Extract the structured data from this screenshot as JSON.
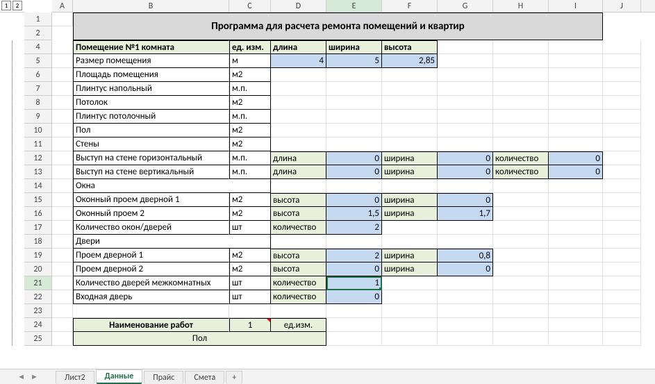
{
  "outlineLevels": [
    "1",
    "2"
  ],
  "columns": [
    "A",
    "B",
    "C",
    "D",
    "E",
    "F",
    "G",
    "H",
    "I",
    "J"
  ],
  "selectedCol": "E",
  "selectedRow": "21",
  "rows": [
    "1",
    "2",
    "4",
    "5",
    "6",
    "7",
    "8",
    "9",
    "10",
    "11",
    "12",
    "13",
    "14",
    "15",
    "16",
    "17",
    "18",
    "19",
    "20",
    "21",
    "22",
    "23",
    "24",
    "25"
  ],
  "title": "Программа для расчета ремонта помещений и квартир",
  "header": {
    "room": "Помещение №1 комната",
    "unit": "ед. изм.",
    "len": "длина",
    "wid": "ширина",
    "hgt": "высота"
  },
  "r5": {
    "name": "Размер помещения",
    "unit": "м",
    "len": "4",
    "wid": "5",
    "hgt": "2,85"
  },
  "r6": {
    "name": "Площадь помещения",
    "unit": "м2"
  },
  "r7": {
    "name": "Плинтус напольный",
    "unit": "м.п."
  },
  "r8": {
    "name": "Потолок",
    "unit": "м2"
  },
  "r9": {
    "name": "Плинтус потолочный",
    "unit": "м.п."
  },
  "r10": {
    "name": "Пол",
    "unit": "м2"
  },
  "r11": {
    "name": "Стены",
    "unit": "м2"
  },
  "r12": {
    "name": "Выступ на стене горизонтальный",
    "unit": "м.п.",
    "d": "длина",
    "e": "0",
    "f": "ширина",
    "g": "0",
    "h": "количество",
    "i": "0"
  },
  "r13": {
    "name": "Выступ на стене вертикальный",
    "unit": "м.п.",
    "d": "длина",
    "e": "0",
    "f": "ширина",
    "g": "0",
    "h": "количество",
    "i": "0"
  },
  "r14": {
    "name": "Окна"
  },
  "r15": {
    "name": "Оконный проем дверной 1",
    "unit": "м2",
    "d": "высота",
    "e": "0",
    "f": "ширина",
    "g": "0"
  },
  "r16": {
    "name": "Оконный проем 2",
    "unit": "м2",
    "d": "высота",
    "e": "1,5",
    "f": "ширина",
    "g": "1,7"
  },
  "r17": {
    "name": "Количество окон/дверей",
    "unit": "шт",
    "d": "количество",
    "e": "2"
  },
  "r18": {
    "name": "Двери"
  },
  "r19": {
    "name": "Проем дверной 1",
    "unit": "м2",
    "d": "высота",
    "e": "2",
    "f": "ширина",
    "g": "0,8"
  },
  "r20": {
    "name": "Проем дверной 2",
    "unit": "м2",
    "d": "высота",
    "e": "0",
    "f": "ширина",
    "g": "0"
  },
  "r21": {
    "name": "Количество дверей межкомнатных",
    "unit": "шт",
    "d": "количество",
    "e": "1"
  },
  "r22": {
    "name": "Входная дверь",
    "unit": "шт",
    "d": "количество",
    "e": "0"
  },
  "r24": {
    "name": "Наименование работ",
    "c": "1",
    "d": "ед.изм."
  },
  "r25": {
    "name": "Пол"
  },
  "tabs": {
    "0": "Лист2",
    "1": "Данные",
    "2": "Прайс",
    "3": "Смета",
    "add": "+"
  }
}
